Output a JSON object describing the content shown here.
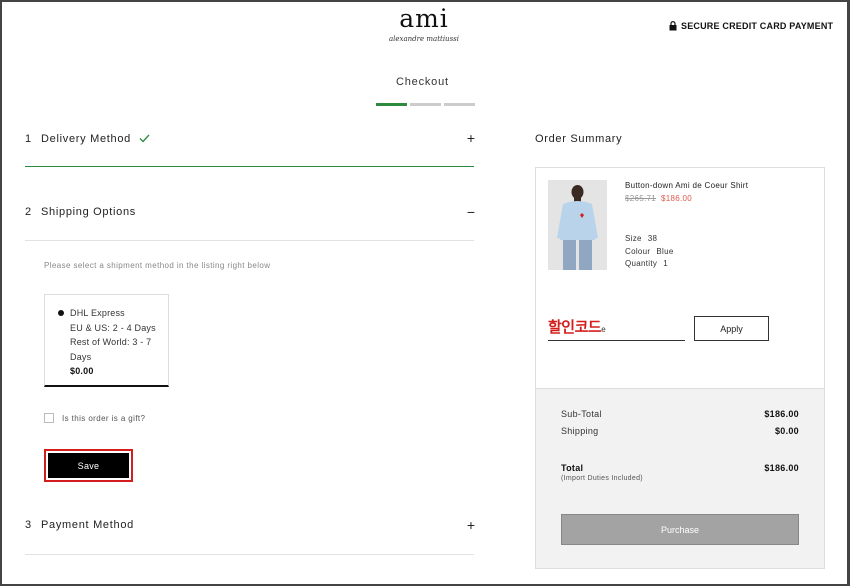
{
  "header": {
    "logo_main": "ami",
    "logo_sub": "alexandre mattiussi",
    "secure_label": "SECURE CREDIT CARD PAYMENT",
    "lock_icon": "lock-icon"
  },
  "checkout": {
    "title": "Checkout",
    "progress_steps_completed": 1,
    "progress_steps_total": 3
  },
  "sections": {
    "delivery": {
      "number": "1",
      "title": "Delivery Method",
      "toggle": "+",
      "status_icon": "check-icon"
    },
    "shipping": {
      "number": "2",
      "title": "Shipping Options",
      "toggle": "−"
    },
    "payment": {
      "number": "3",
      "title": "Payment Method",
      "toggle": "+"
    }
  },
  "shipping_options": {
    "hint": "Please select a shipment method in the listing right below",
    "option": {
      "carrier": "DHL Express",
      "eu_us": "EU & US: 2 - 4 Days",
      "rest_line1": "Rest of World: 3 - 7",
      "rest_line2": "Days",
      "price": "$0.00",
      "selected": true
    },
    "gift_label": "Is this order is a gift?",
    "save_label": "Save"
  },
  "summary": {
    "title": "Order Summary",
    "product": {
      "name": "Button-down Ami de Coeur Shirt",
      "old_price": "$265.71",
      "new_price": "$186.00",
      "size_label": "Size",
      "size_value": "38",
      "colour_label": "Colour",
      "colour_value": "Blue",
      "quantity_label": "Quantity",
      "quantity_value": "1"
    },
    "promo": {
      "overlay_text": "할인코드",
      "tail_text": "e",
      "apply_label": "Apply"
    },
    "subtotal_label": "Sub-Total",
    "subtotal_value": "$186.00",
    "shipping_label": "Shipping",
    "shipping_value": "$0.00",
    "total_label": "Total",
    "total_note": "(Import Duties Included)",
    "total_value": "$186.00",
    "purchase_label": "Purchase"
  },
  "colors": {
    "accent_green": "#2e8b3d",
    "sale_red": "#e05a4e",
    "highlight_red": "#d41e1e"
  }
}
